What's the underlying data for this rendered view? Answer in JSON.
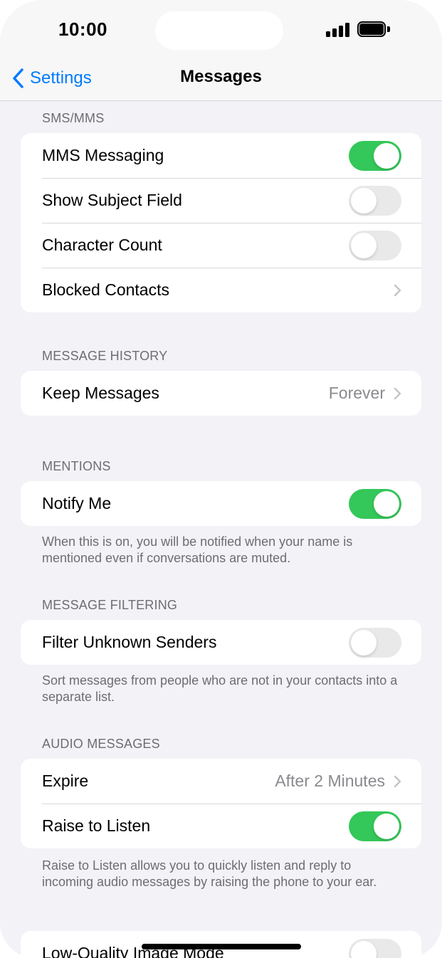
{
  "status_bar": {
    "time": "10:00"
  },
  "nav": {
    "back_label": "Settings",
    "title": "Messages"
  },
  "sections": {
    "sms": {
      "header": "SMS/MMS",
      "rows": [
        {
          "label": "MMS Messaging",
          "toggle": true
        },
        {
          "label": "Show Subject Field",
          "toggle": false
        },
        {
          "label": "Character Count",
          "toggle": false
        },
        {
          "label": "Blocked Contacts"
        }
      ]
    },
    "history": {
      "header": "MESSAGE HISTORY",
      "rows": [
        {
          "label": "Keep Messages",
          "value": "Forever"
        }
      ]
    },
    "mentions": {
      "header": "MENTIONS",
      "rows": [
        {
          "label": "Notify Me",
          "toggle": true
        }
      ],
      "footer": "When this is on, you will be notified when your name is mentioned even if conversations are muted."
    },
    "filtering": {
      "header": "MESSAGE FILTERING",
      "rows": [
        {
          "label": "Filter Unknown Senders",
          "toggle": false
        }
      ],
      "footer": "Sort messages from people who are not in your contacts into a separate list."
    },
    "audio": {
      "header": "AUDIO MESSAGES",
      "rows": [
        {
          "label": "Expire",
          "value": "After 2 Minutes"
        },
        {
          "label": "Raise to Listen",
          "toggle": true
        }
      ],
      "footer": "Raise to Listen allows you to quickly listen and reply to incoming audio messages by raising the phone to your ear."
    },
    "image": {
      "rows": [
        {
          "label": "Low-Quality Image Mode",
          "toggle": false
        }
      ]
    }
  },
  "colors": {
    "accent": "#007aff",
    "toggle_on": "#34c759",
    "toggle_off": "#e9e9ea",
    "background": "#f2f2f7"
  }
}
